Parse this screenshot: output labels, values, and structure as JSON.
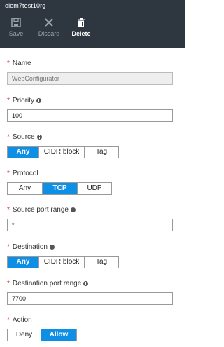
{
  "header": {
    "title": "olem7test10rg",
    "toolbar": {
      "save_label": "Save",
      "discard_label": "Discard",
      "delete_label": "Delete"
    }
  },
  "form": {
    "name": {
      "label": "Name",
      "value": "WebConfigurator"
    },
    "priority": {
      "label": "Priority",
      "value": "100"
    },
    "source": {
      "label": "Source",
      "options": [
        "Any",
        "CIDR block",
        "Tag"
      ],
      "selected": "Any"
    },
    "protocol": {
      "label": "Protocol",
      "options": [
        "Any",
        "TCP",
        "UDP"
      ],
      "selected": "TCP"
    },
    "source_port_range": {
      "label": "Source port range",
      "value": "*"
    },
    "destination": {
      "label": "Destination",
      "options": [
        "Any",
        "CIDR block",
        "Tag"
      ],
      "selected": "Any"
    },
    "destination_port_range": {
      "label": "Destination port range",
      "value": "7700"
    },
    "action": {
      "label": "Action",
      "options": [
        "Deny",
        "Allow"
      ],
      "selected": "Allow"
    }
  },
  "colors": {
    "header_bg": "#2e3640",
    "accent": "#0e8fe6",
    "required_star": "#d9302c"
  }
}
